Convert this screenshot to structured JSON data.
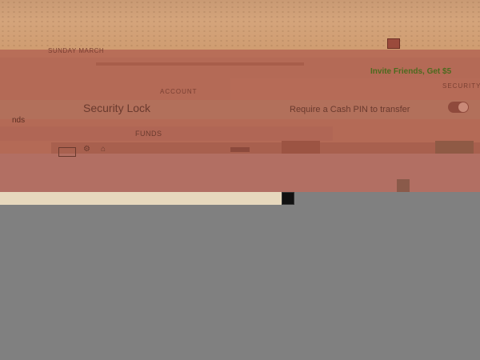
{
  "status_bar": {
    "text": "SUNDAY MARCH"
  },
  "banner": {
    "invite_label": "Invite Friends, Get $5"
  },
  "sections": {
    "account_header": "ACCOUNT",
    "security_header": "SECURITY",
    "funds_header": "FUNDS",
    "funds_left_label": "nds"
  },
  "security": {
    "lock_title": "Security Lock",
    "pin_label": "Require a Cash PIN to transfer",
    "pin_toggle_on": true
  },
  "icons": {
    "gift": "gift-icon",
    "card": "card-icon",
    "gear": "gear-icon",
    "bank": "bank-icon"
  },
  "colors": {
    "screen": "#b46a56",
    "accent_green": "#4b6a1e",
    "wall": "#d4a47b"
  }
}
